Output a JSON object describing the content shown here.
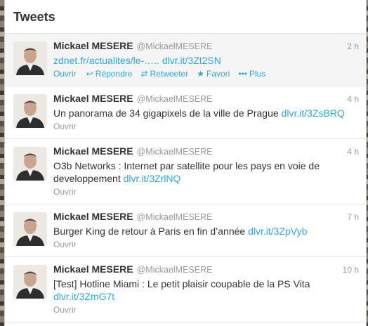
{
  "panel": {
    "title": "Tweets"
  },
  "tweets": [
    {
      "name": "Mickael MESERE",
      "handle": "@MickaelMESERE",
      "time": "2 h",
      "text": "zdnet.fr/actualites/le-…..",
      "link": "dlvr.it/3Zt2SN",
      "open": "Ouvrir",
      "actions": {
        "reply": "Répondre",
        "retweet": "Retweeter",
        "favorite": "Favori",
        "more": "Plus"
      }
    },
    {
      "name": "Mickael MESERE",
      "handle": "@MickaelMESERE",
      "time": "4 h",
      "text": "Un panorama de 34 gigapixels de la ville de Prague",
      "link": "dlvr.it/3ZsBRQ",
      "open": "Ouvrir"
    },
    {
      "name": "Mickael MESERE",
      "handle": "@MickaelMESERE",
      "time": "4 h",
      "text": "O3b Networks : Internet par satellite pour les pays en voie de developpement",
      "link": "dlvr.it/3ZrlNQ",
      "open": "Ouvrir"
    },
    {
      "name": "Mickael MESERE",
      "handle": "@MickaelMESERE",
      "time": "7 h",
      "text": "Burger King de retour à Paris en fin d’année",
      "link": "dlvr.it/3ZpVyb",
      "open": "Ouvrir"
    },
    {
      "name": "Mickael MESERE",
      "handle": "@MickaelMESERE",
      "time": "10 h",
      "text": "[Test] Hotline Miami : Le petit plaisir coupable de la PS Vita",
      "link": "dlvr.it/3ZmG7t",
      "open": "Ouvrir"
    }
  ],
  "colors": {
    "link": "#2fa7dc",
    "meta": "#999999",
    "text": "#333333"
  }
}
